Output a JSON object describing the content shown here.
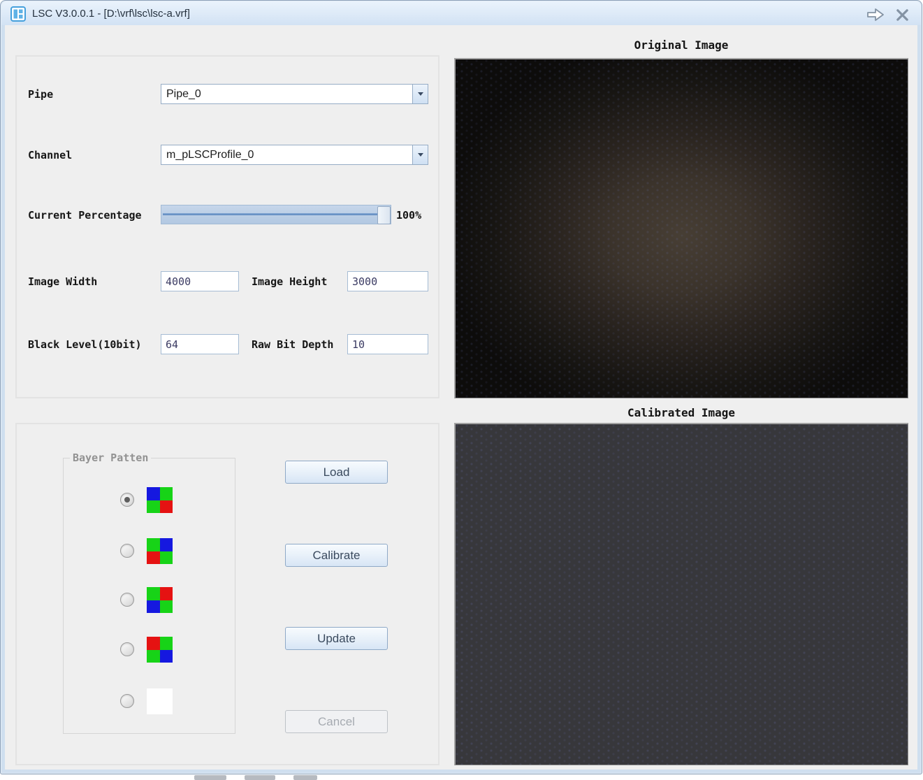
{
  "window": {
    "title": "LSC V3.0.0.1 - [D:\\vrf\\lsc\\lsc-a.vrf]"
  },
  "settings": {
    "pipe": {
      "label": "Pipe",
      "value": "Pipe_0"
    },
    "channel": {
      "label": "Channel",
      "value": "m_pLSCProfile_0"
    },
    "current_percentage": {
      "label": "Current Percentage",
      "percent": 100,
      "value_text": "100%"
    },
    "image_width": {
      "label": "Image Width",
      "value": "4000"
    },
    "image_height": {
      "label": "Image Height",
      "value": "3000"
    },
    "black_level": {
      "label": "Black Level(10bit)",
      "value": "64"
    },
    "raw_bit_depth": {
      "label": "Raw Bit Depth",
      "value": "10"
    }
  },
  "bayer": {
    "group_label": "Bayer Patten",
    "colors": {
      "red": "#e51212",
      "green": "#17d317",
      "blue": "#1518e0",
      "white": "#ffffff"
    },
    "options": [
      {
        "name": "BGGR",
        "cells": [
          "blue",
          "green",
          "green",
          "red"
        ],
        "selected": true
      },
      {
        "name": "GBRG",
        "cells": [
          "green",
          "blue",
          "red",
          "green"
        ],
        "selected": false
      },
      {
        "name": "GRBG",
        "cells": [
          "green",
          "red",
          "blue",
          "green"
        ],
        "selected": false
      },
      {
        "name": "RGGB",
        "cells": [
          "red",
          "green",
          "green",
          "blue"
        ],
        "selected": false
      },
      {
        "name": "MONO",
        "cells": [
          "white",
          "white",
          "white",
          "white"
        ],
        "selected": false
      }
    ]
  },
  "buttons": [
    {
      "label": "Load",
      "enabled": true
    },
    {
      "label": "Calibrate",
      "enabled": true
    },
    {
      "label": "Update",
      "enabled": true
    },
    {
      "label": "Cancel",
      "enabled": false
    }
  ],
  "images": {
    "original": {
      "title": "Original Image"
    },
    "calibrated": {
      "title": "Calibrated Image"
    }
  }
}
